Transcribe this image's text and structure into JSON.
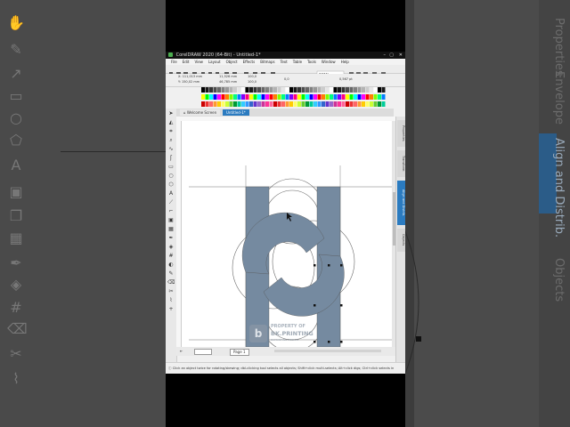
{
  "app": {
    "title": "CorelDRAW 2020 (64-Bit) - Untitled-1*",
    "menu": [
      "File",
      "Edit",
      "View",
      "Layout",
      "Object",
      "Effects",
      "Bitmaps",
      "Text",
      "Table",
      "Tools",
      "Window",
      "Help"
    ],
    "property_bar": {
      "x": "X: 111,013 mm",
      "y": "Y: 150,02 mm",
      "w": "11,526 mm",
      "h": "46,785 mm",
      "scale_w": "100,0",
      "scale_h": "100,0",
      "rotation": "0,0",
      "zoom": "121%",
      "outline": "0,567 pt"
    },
    "tabs": [
      "Welcome Screen",
      "Untitled-1*"
    ],
    "dock_tabs": [
      "Properties",
      "Transform",
      "Align and Distrib.",
      "Objects"
    ],
    "page_tab": "Page 1",
    "status": "Click an object twice for rotating/skewing; dbl-clicking tool selects all objects; Shift+click multi-selects; Alt+click digs; Ctrl+click selects in"
  },
  "watermark": {
    "line1": "PROPERTY OF",
    "line2": "BK.PRINTING",
    "line3": "BKPRINTING DESIGN"
  },
  "background_right_tabs": [
    "Properties",
    "Envelope",
    "Align and Distrib.",
    "Objects"
  ],
  "colors": {
    "shape_fill": "#758aa0",
    "accent_tab": "#2b7bc0",
    "titlebar": "#111111"
  }
}
